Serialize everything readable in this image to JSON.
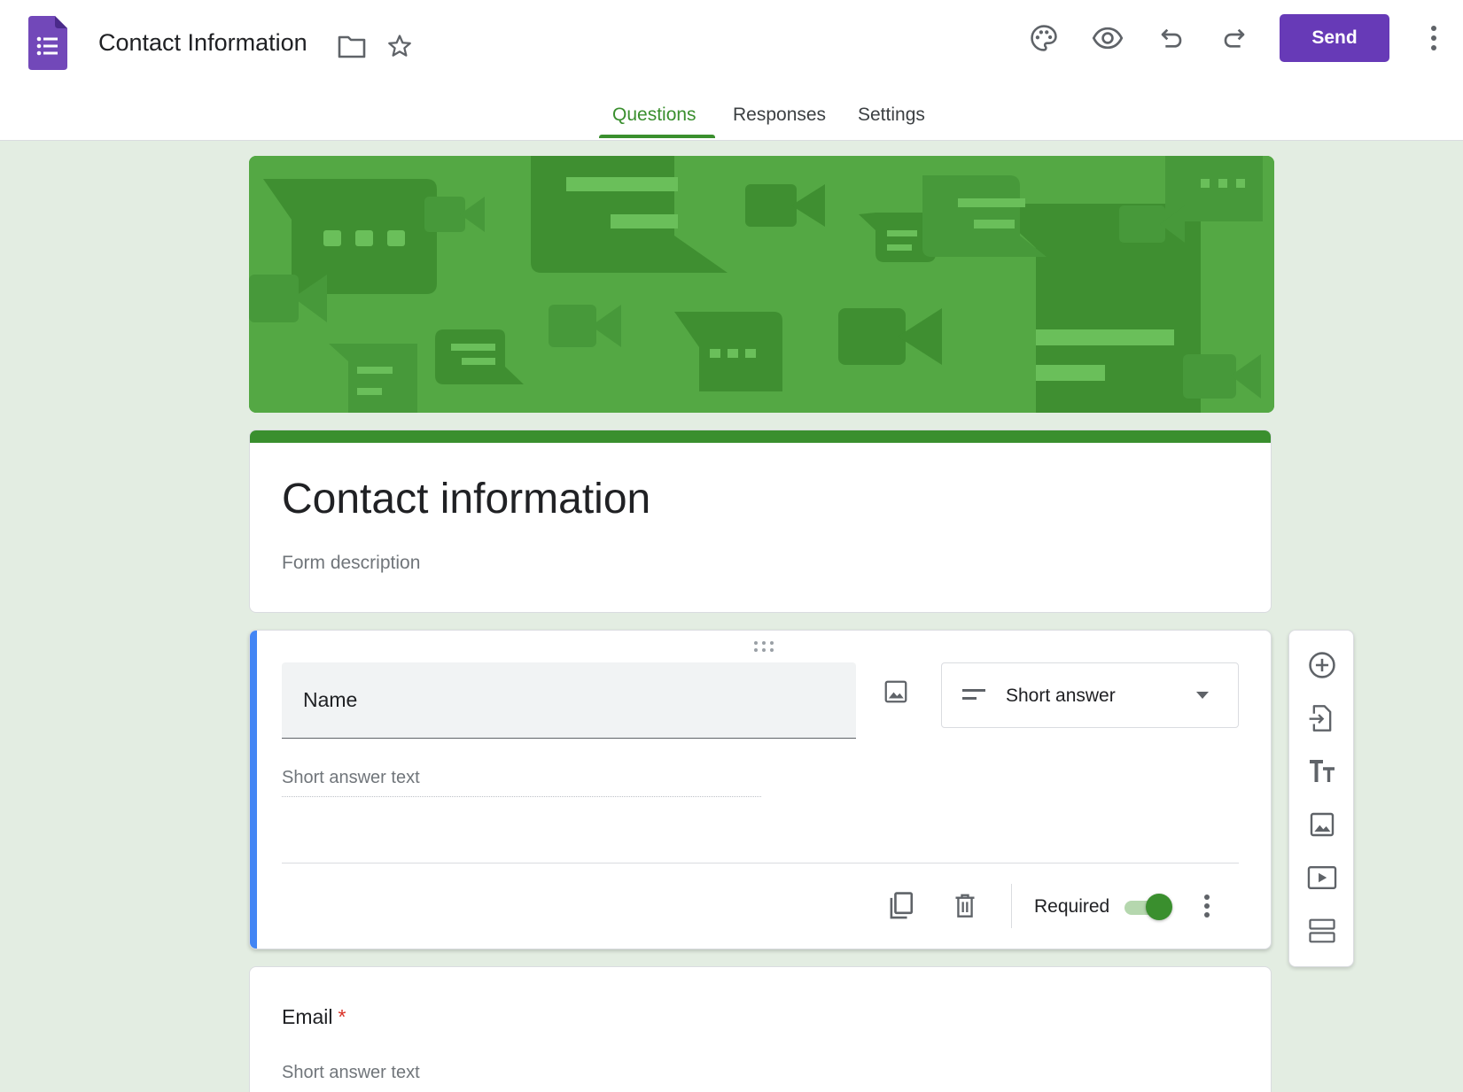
{
  "header": {
    "doc_title": "Contact Information",
    "logo_icon": "google-forms-logo",
    "title_icons": [
      "folder-icon",
      "star-icon"
    ],
    "actions": [
      "palette-icon",
      "preview-eye-icon",
      "undo-icon",
      "redo-icon"
    ],
    "send_label": "Send",
    "more_icon": "more-vert-icon"
  },
  "tabs": [
    {
      "label": "Questions",
      "active": true
    },
    {
      "label": "Responses",
      "active": false
    },
    {
      "label": "Settings",
      "active": false
    }
  ],
  "form": {
    "title": "Contact information",
    "description_placeholder": "Form description"
  },
  "questions": [
    {
      "title": "Name",
      "type": "Short answer",
      "answer_placeholder": "Short answer text",
      "required_label": "Required",
      "required": true
    },
    {
      "title": "Email",
      "required_mark": "*",
      "answer_placeholder": "Short answer text"
    }
  ],
  "toolbar": [
    "add-question-icon",
    "import-questions-icon",
    "add-title-icon",
    "add-image-icon",
    "add-video-icon",
    "add-section-icon"
  ],
  "colors": {
    "theme": "#3a8f2e",
    "background": "#e3ede2",
    "banner": "#54a844",
    "send_button": "#673ab7",
    "active_card_bar": "#4285f4",
    "required_star": "#d93025"
  }
}
